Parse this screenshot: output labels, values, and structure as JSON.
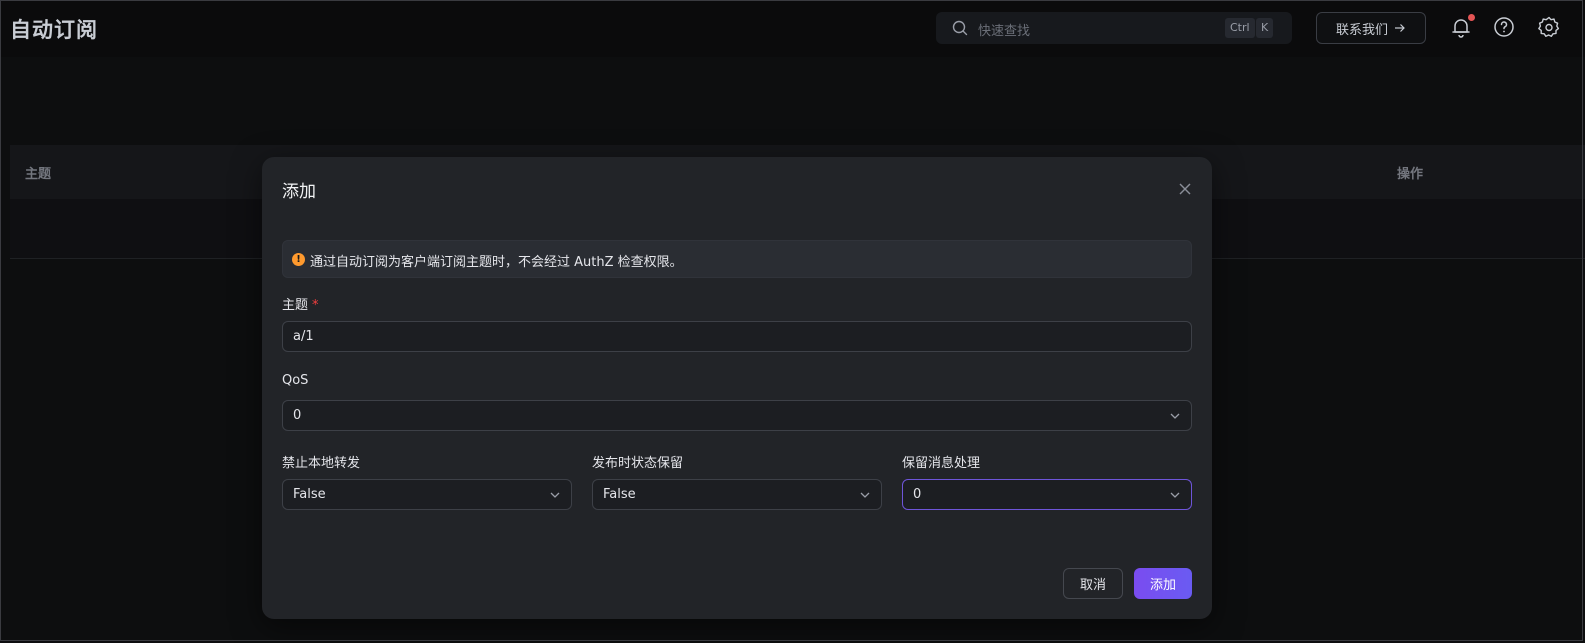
{
  "app": {
    "title": "自动订阅"
  },
  "header": {
    "search_placeholder": "快速查找",
    "kbd_ctrl": "Ctrl",
    "kbd_k": "K",
    "contact_label": "联系我们",
    "icons": [
      "search-icon",
      "arrow-right-icon",
      "bell-icon",
      "help-icon",
      "gear-icon"
    ]
  },
  "table": {
    "columns": [
      "主题",
      "操作"
    ]
  },
  "modal": {
    "title": "添加",
    "alert_text": "通过自动订阅为客户端订阅主题时，不会经过 AuthZ 检查权限。",
    "fields": {
      "topic": {
        "label": "主题",
        "required_mark": "*",
        "value": "a/1"
      },
      "qos": {
        "label": "QoS",
        "value": "0"
      },
      "no_local": {
        "label": "禁止本地转发",
        "value": "False"
      },
      "retain_as_published": {
        "label": "发布时状态保留",
        "value": "False"
      },
      "retain_handling": {
        "label": "保留消息处理",
        "value": "0"
      }
    },
    "cancel_label": "取消",
    "submit_label": "添加"
  },
  "colors": {
    "accent": "#6e55d9",
    "warning": "#ff9a2e",
    "required": "#f53f3f",
    "notification_dot": "#e45555"
  }
}
